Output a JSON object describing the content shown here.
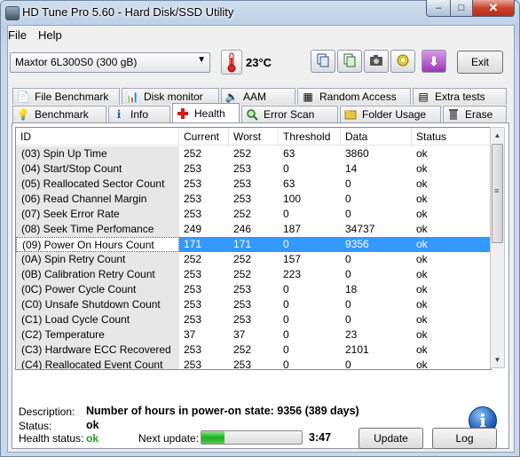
{
  "window": {
    "title": "HD Tune Pro 5.60 - Hard Disk/SSD Utility",
    "min": "–",
    "max": "□",
    "close": "✕"
  },
  "menu": {
    "file": "File",
    "help": "Help"
  },
  "toolbar": {
    "drive": "Maxtor  6L300S0 (300 gB)",
    "temperature": "23°C",
    "exit": "Exit"
  },
  "tabs_top": [
    "File Benchmark",
    "Disk monitor",
    "AAM",
    "Random Access",
    "Extra tests"
  ],
  "tabs_bottom": [
    "Benchmark",
    "Info",
    "Health",
    "Error Scan",
    "Folder Usage",
    "Erase"
  ],
  "table": {
    "headers": [
      "ID",
      "Current",
      "Worst",
      "Threshold",
      "Data",
      "Status"
    ],
    "rows": [
      [
        "(03) Spin Up Time",
        "252",
        "252",
        "63",
        "3860",
        "ok"
      ],
      [
        "(04) Start/Stop Count",
        "253",
        "253",
        "0",
        "14",
        "ok"
      ],
      [
        "(05) Reallocated Sector Count",
        "253",
        "253",
        "63",
        "0",
        "ok"
      ],
      [
        "(06) Read Channel Margin",
        "253",
        "253",
        "100",
        "0",
        "ok"
      ],
      [
        "(07) Seek Error Rate",
        "253",
        "252",
        "0",
        "0",
        "ok"
      ],
      [
        "(08) Seek Time Perfomance",
        "249",
        "246",
        "187",
        "34737",
        "ok"
      ],
      [
        "(09) Power On Hours Count",
        "171",
        "171",
        "0",
        "9356",
        "ok"
      ],
      [
        "(0A) Spin Retry Count",
        "252",
        "252",
        "157",
        "0",
        "ok"
      ],
      [
        "(0B) Calibration Retry Count",
        "253",
        "252",
        "223",
        "0",
        "ok"
      ],
      [
        "(0C) Power Cycle Count",
        "253",
        "253",
        "0",
        "18",
        "ok"
      ],
      [
        "(C0) Unsafe Shutdown Count",
        "253",
        "253",
        "0",
        "0",
        "ok"
      ],
      [
        "(C1) Load Cycle Count",
        "253",
        "253",
        "0",
        "0",
        "ok"
      ],
      [
        "(C2) Temperature",
        "37",
        "37",
        "0",
        "23",
        "ok"
      ],
      [
        "(C3) Hardware ECC Recovered",
        "253",
        "252",
        "0",
        "2101",
        "ok"
      ],
      [
        "(C4) Reallocated Event Count",
        "253",
        "253",
        "0",
        "0",
        "ok"
      ]
    ],
    "selected_index": 6
  },
  "description": {
    "label": "Description:",
    "value": "Number of hours in power-on state: 9356 (389 days)"
  },
  "status": {
    "label": "Status:",
    "value": "ok"
  },
  "footer": {
    "health_label": "Health status:",
    "health_value": "ok",
    "next_update_label": "Next update:",
    "progress_fraction": 0.23,
    "countdown": "3:47",
    "update_button": "Update",
    "log_button": "Log"
  },
  "colors": {
    "selection": "#3399ff",
    "ok_green": "#19a319",
    "accent_blue": "#1f5fb8"
  }
}
